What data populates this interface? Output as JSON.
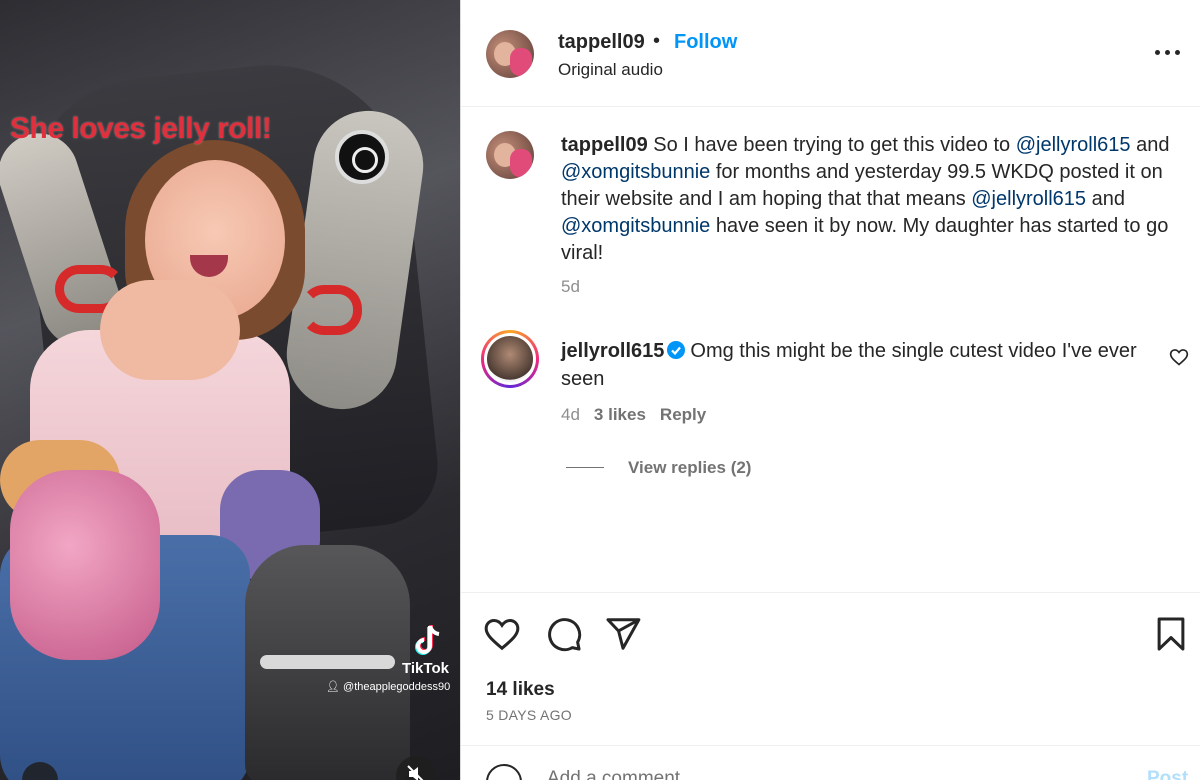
{
  "media": {
    "overlay_caption": "She loves jelly roll!",
    "watermark_brand": "TikTok",
    "watermark_user": "@theapplegoddess90",
    "mute_icon": "speaker-muted-icon"
  },
  "header": {
    "username": "tappell09",
    "separator": "•",
    "follow_label": "Follow",
    "audio_label": "Original audio",
    "more_icon": "more-horizontal-icon"
  },
  "caption": {
    "username": "tappell09",
    "t1": " So I have been trying to get this video to ",
    "m1": "@jellyroll615",
    "t2": " and ",
    "m2": "@xomgitsbunnie",
    "t3": " for months and yesterday 99.5 WKDQ posted it on their website and I am hoping that that means ",
    "m3": "@jellyroll615",
    "t4": " and ",
    "m4": "@xomgitsbunnie",
    "t5": " have seen it by now. My daughter has started to go viral!",
    "time": "5d"
  },
  "comment": {
    "username": "jellyroll615",
    "text": "Omg this might be the single cutest video I've ever seen",
    "time": "4d",
    "likes": "3 likes",
    "reply_label": "Reply",
    "view_replies": "View replies (2)"
  },
  "actions": {
    "likes_count": "14 likes",
    "date": "5 DAYS AGO"
  },
  "add_comment": {
    "placeholder": "Add a comment...",
    "post_label": "Post"
  },
  "colors": {
    "accent": "#0095f6",
    "mention": "#00376b",
    "muted": "#737373",
    "overlay_red": "#e0303d"
  }
}
